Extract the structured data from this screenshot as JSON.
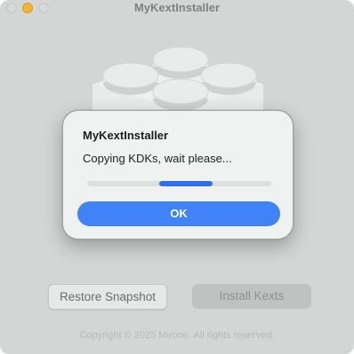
{
  "window": {
    "title": "MyKextInstaller"
  },
  "icons": {
    "app_icon": "lego-brick-icon"
  },
  "footer": {
    "restore_label": "Restore Snapshot",
    "install_label": "Install Kexts",
    "copyright": "Copyright © 2025 Mirone. All rights reserved."
  },
  "dialog": {
    "title": "MyKextInstaller",
    "message": "Copying KDKs, wait please...",
    "ok_label": "OK",
    "progress": {
      "indeterminate": true,
      "segment_start": 0.39,
      "segment_end": 0.68
    }
  },
  "colors": {
    "accent": "#3f83f6",
    "progress": "#2f6fe8",
    "minimize_button": "#f1b433"
  }
}
